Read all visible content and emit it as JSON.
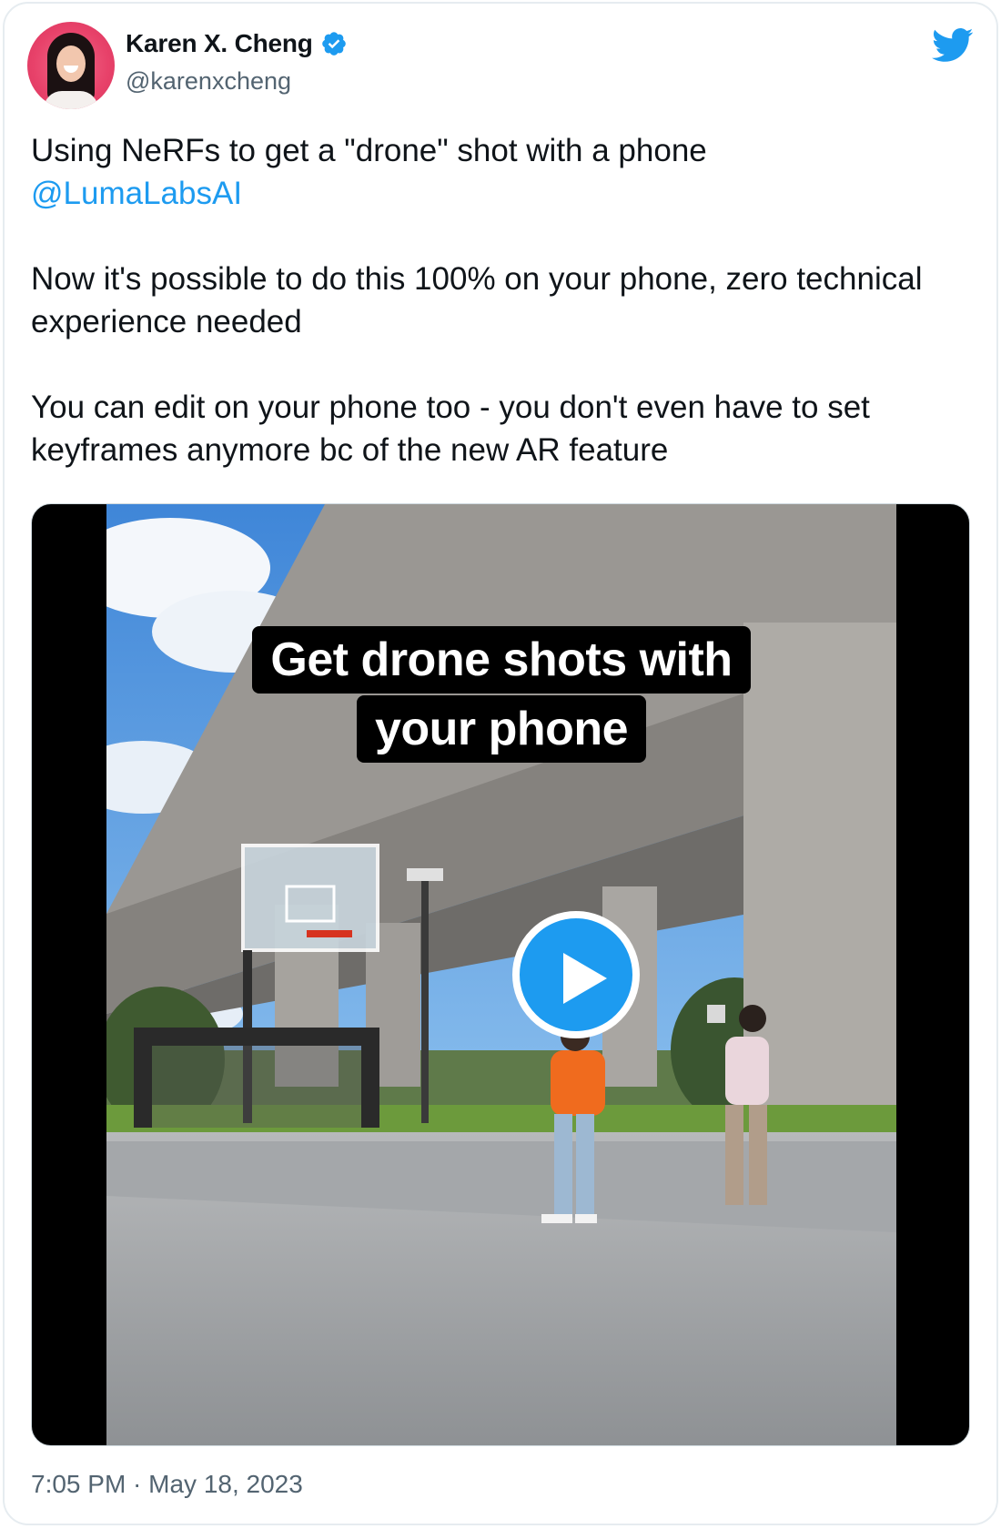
{
  "author": {
    "display_name": "Karen X. Cheng",
    "handle": "@karenxcheng",
    "verified": true,
    "avatar_icon": "profile-photo"
  },
  "brand": {
    "icon": "twitter-bird-icon",
    "accent_color": "#1d9bf0"
  },
  "tweet": {
    "line1": "Using NeRFs to get a \"drone\" shot with a phone",
    "mention": "@LumaLabsAI",
    "para2": "Now it's possible to do this 100% on your phone, zero technical experience needed",
    "para3": "You can edit on your phone too - you don't even have to set keyframes anymore bc of the new AR feature"
  },
  "media": {
    "type": "video",
    "caption_line1": "Get drone shots with",
    "caption_line2": "your phone",
    "play_icon": "play-icon"
  },
  "meta": {
    "timestamp": "7:05 PM · May 18, 2023"
  }
}
